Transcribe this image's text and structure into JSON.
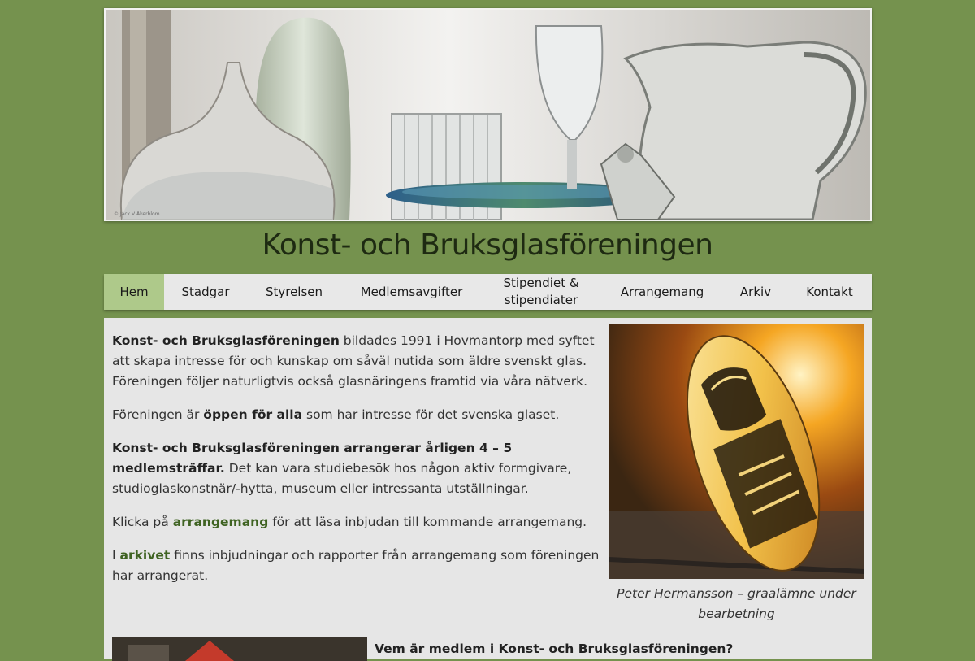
{
  "site": {
    "title": "Konst- och Bruksglasföreningen",
    "banner_credit": "© Jack V Åkerblom"
  },
  "nav": {
    "items": [
      {
        "label": "Hem",
        "active": true
      },
      {
        "label": "Stadgar",
        "active": false
      },
      {
        "label": "Styrelsen",
        "active": false
      },
      {
        "label": "Medlemsavgifter",
        "active": false
      },
      {
        "label": "Stipendiet &\nstipendiater",
        "active": false
      },
      {
        "label": "Arrangemang",
        "active": false
      },
      {
        "label": "Arkiv",
        "active": false
      },
      {
        "label": "Kontakt",
        "active": false
      }
    ]
  },
  "content": {
    "p1": {
      "strong": "Konst- och Bruksglasföreningen",
      "rest": " bildades 1991 i Hovmantorp med syftet att skapa intresse för och kunskap om såväl nutida som äldre svenskt glas. Föreningen följer naturligtvis också glasnäringens framtid via våra nätverk."
    },
    "p2": {
      "before": "Föreningen är ",
      "strong": "öppen för alla",
      "after": " som har intresse för det svenska glaset."
    },
    "p3": {
      "strong": "Konst- och Bruksglasföreningen arrangerar årligen 4 – 5 medlemsträffar.",
      "rest": " Det kan vara studiebesök hos någon aktiv formgivare, studioglaskonstnär/-hytta, museum eller intressanta utställningar."
    },
    "p4": {
      "before": "Klicka på ",
      "link": "arrangemang",
      "after": " för att läsa inbjudan till kommande arrangemang."
    },
    "p5": {
      "before": "I ",
      "link": "arkivet",
      "after": " finns inbjudningar och rapporter från arrangemang som föreningen har arrangerat."
    },
    "photo_caption": "Peter Hermansson – graalämne under bearbetning",
    "next_heading_partial": "Vem är medlem i Konst- och Bruksglasföreningen?"
  },
  "colors": {
    "page_bg": "#75924e",
    "nav_active": "#aec98a",
    "link": "#3f6322"
  }
}
